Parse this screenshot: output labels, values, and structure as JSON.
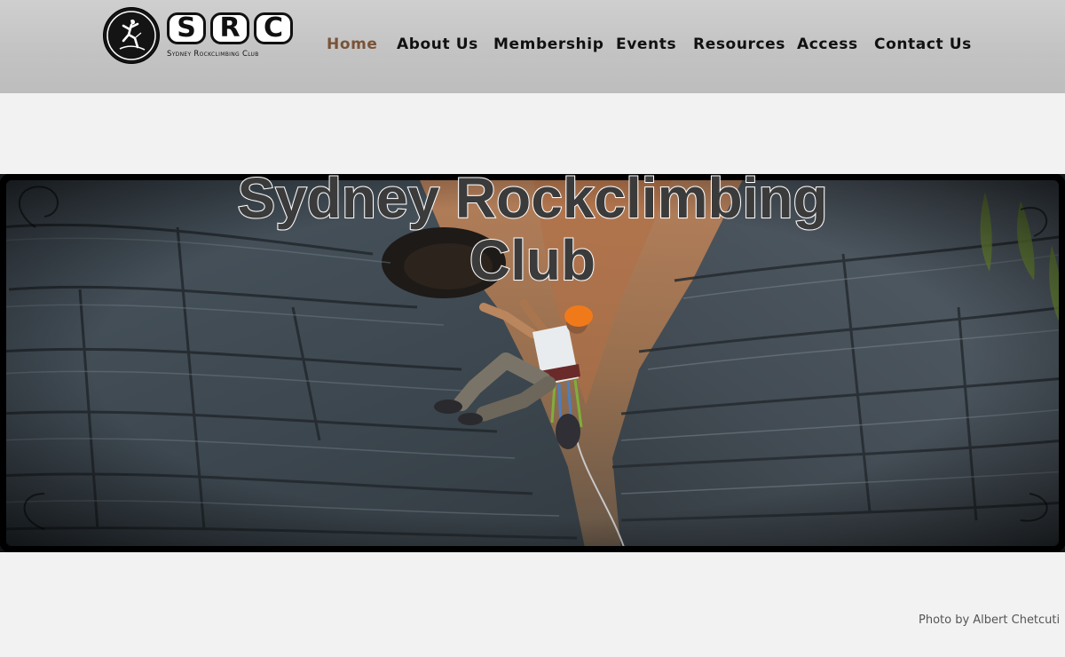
{
  "header": {
    "logo": {
      "letters": [
        "S",
        "R",
        "C"
      ],
      "tagline": "Sydney Rockclimbing Club"
    },
    "nav": {
      "items": [
        {
          "label": "Home",
          "active": true
        },
        {
          "label": "About Us",
          "active": false
        },
        {
          "label": "Membership",
          "active": false
        },
        {
          "label": "Events",
          "active": false
        },
        {
          "label": "Resources",
          "active": false
        },
        {
          "label": "Access",
          "active": false
        },
        {
          "label": "Contact Us",
          "active": false
        }
      ]
    }
  },
  "hero": {
    "title": "Sydney Rockclimbing Club"
  },
  "footer": {
    "photo_credit": "Photo by Albert Chetcuti"
  },
  "colors": {
    "header_bg": "#c4c4c4",
    "page_bg": "#f2f2f2",
    "nav_text": "#111111",
    "nav_active": "#7a5338",
    "climber_helmet": "#f07a1a"
  },
  "icons": [
    "climber-logo-icon"
  ]
}
